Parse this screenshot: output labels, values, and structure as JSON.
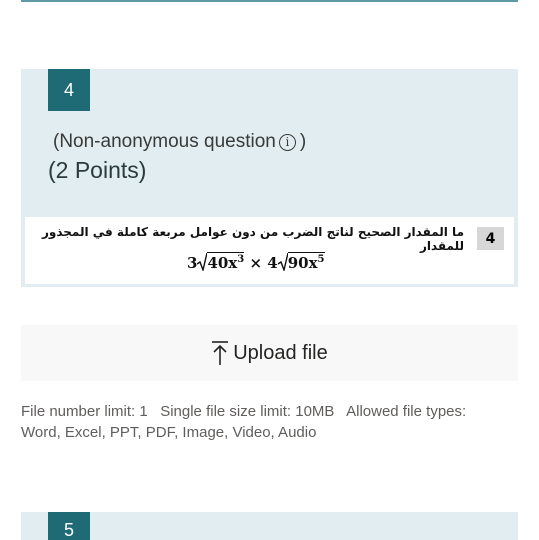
{
  "question": {
    "number": "4",
    "non_anonymous_prefix": "(Non-anonymous question",
    "non_anonymous_suffix": ")",
    "info_icon": "info-icon",
    "points": "(2 Points)",
    "image": {
      "number": "4",
      "arabic_text": "ما المقدار الصحيح لناتج الضرب من دون عوامل مربعة كاملة في المجذور للمقدار",
      "formula_coef1": "3",
      "formula_rad1": "40x",
      "formula_exp1": "3",
      "formula_times": "×",
      "formula_coef2": "4",
      "formula_rad2": "90x",
      "formula_exp2": "5"
    }
  },
  "upload": {
    "icon": "upload-icon",
    "label": "Upload file"
  },
  "file_limits": {
    "text": "File number limit: 1   Single file size limit: 10MB   Allowed file types: Word, Excel, PPT, PDF, Image, Video, Audio"
  },
  "next_question": {
    "number": "5"
  },
  "colors": {
    "accent": "#1e6b76",
    "card_bg": "#e1edf0",
    "upload_bg": "#f8f8f8"
  }
}
